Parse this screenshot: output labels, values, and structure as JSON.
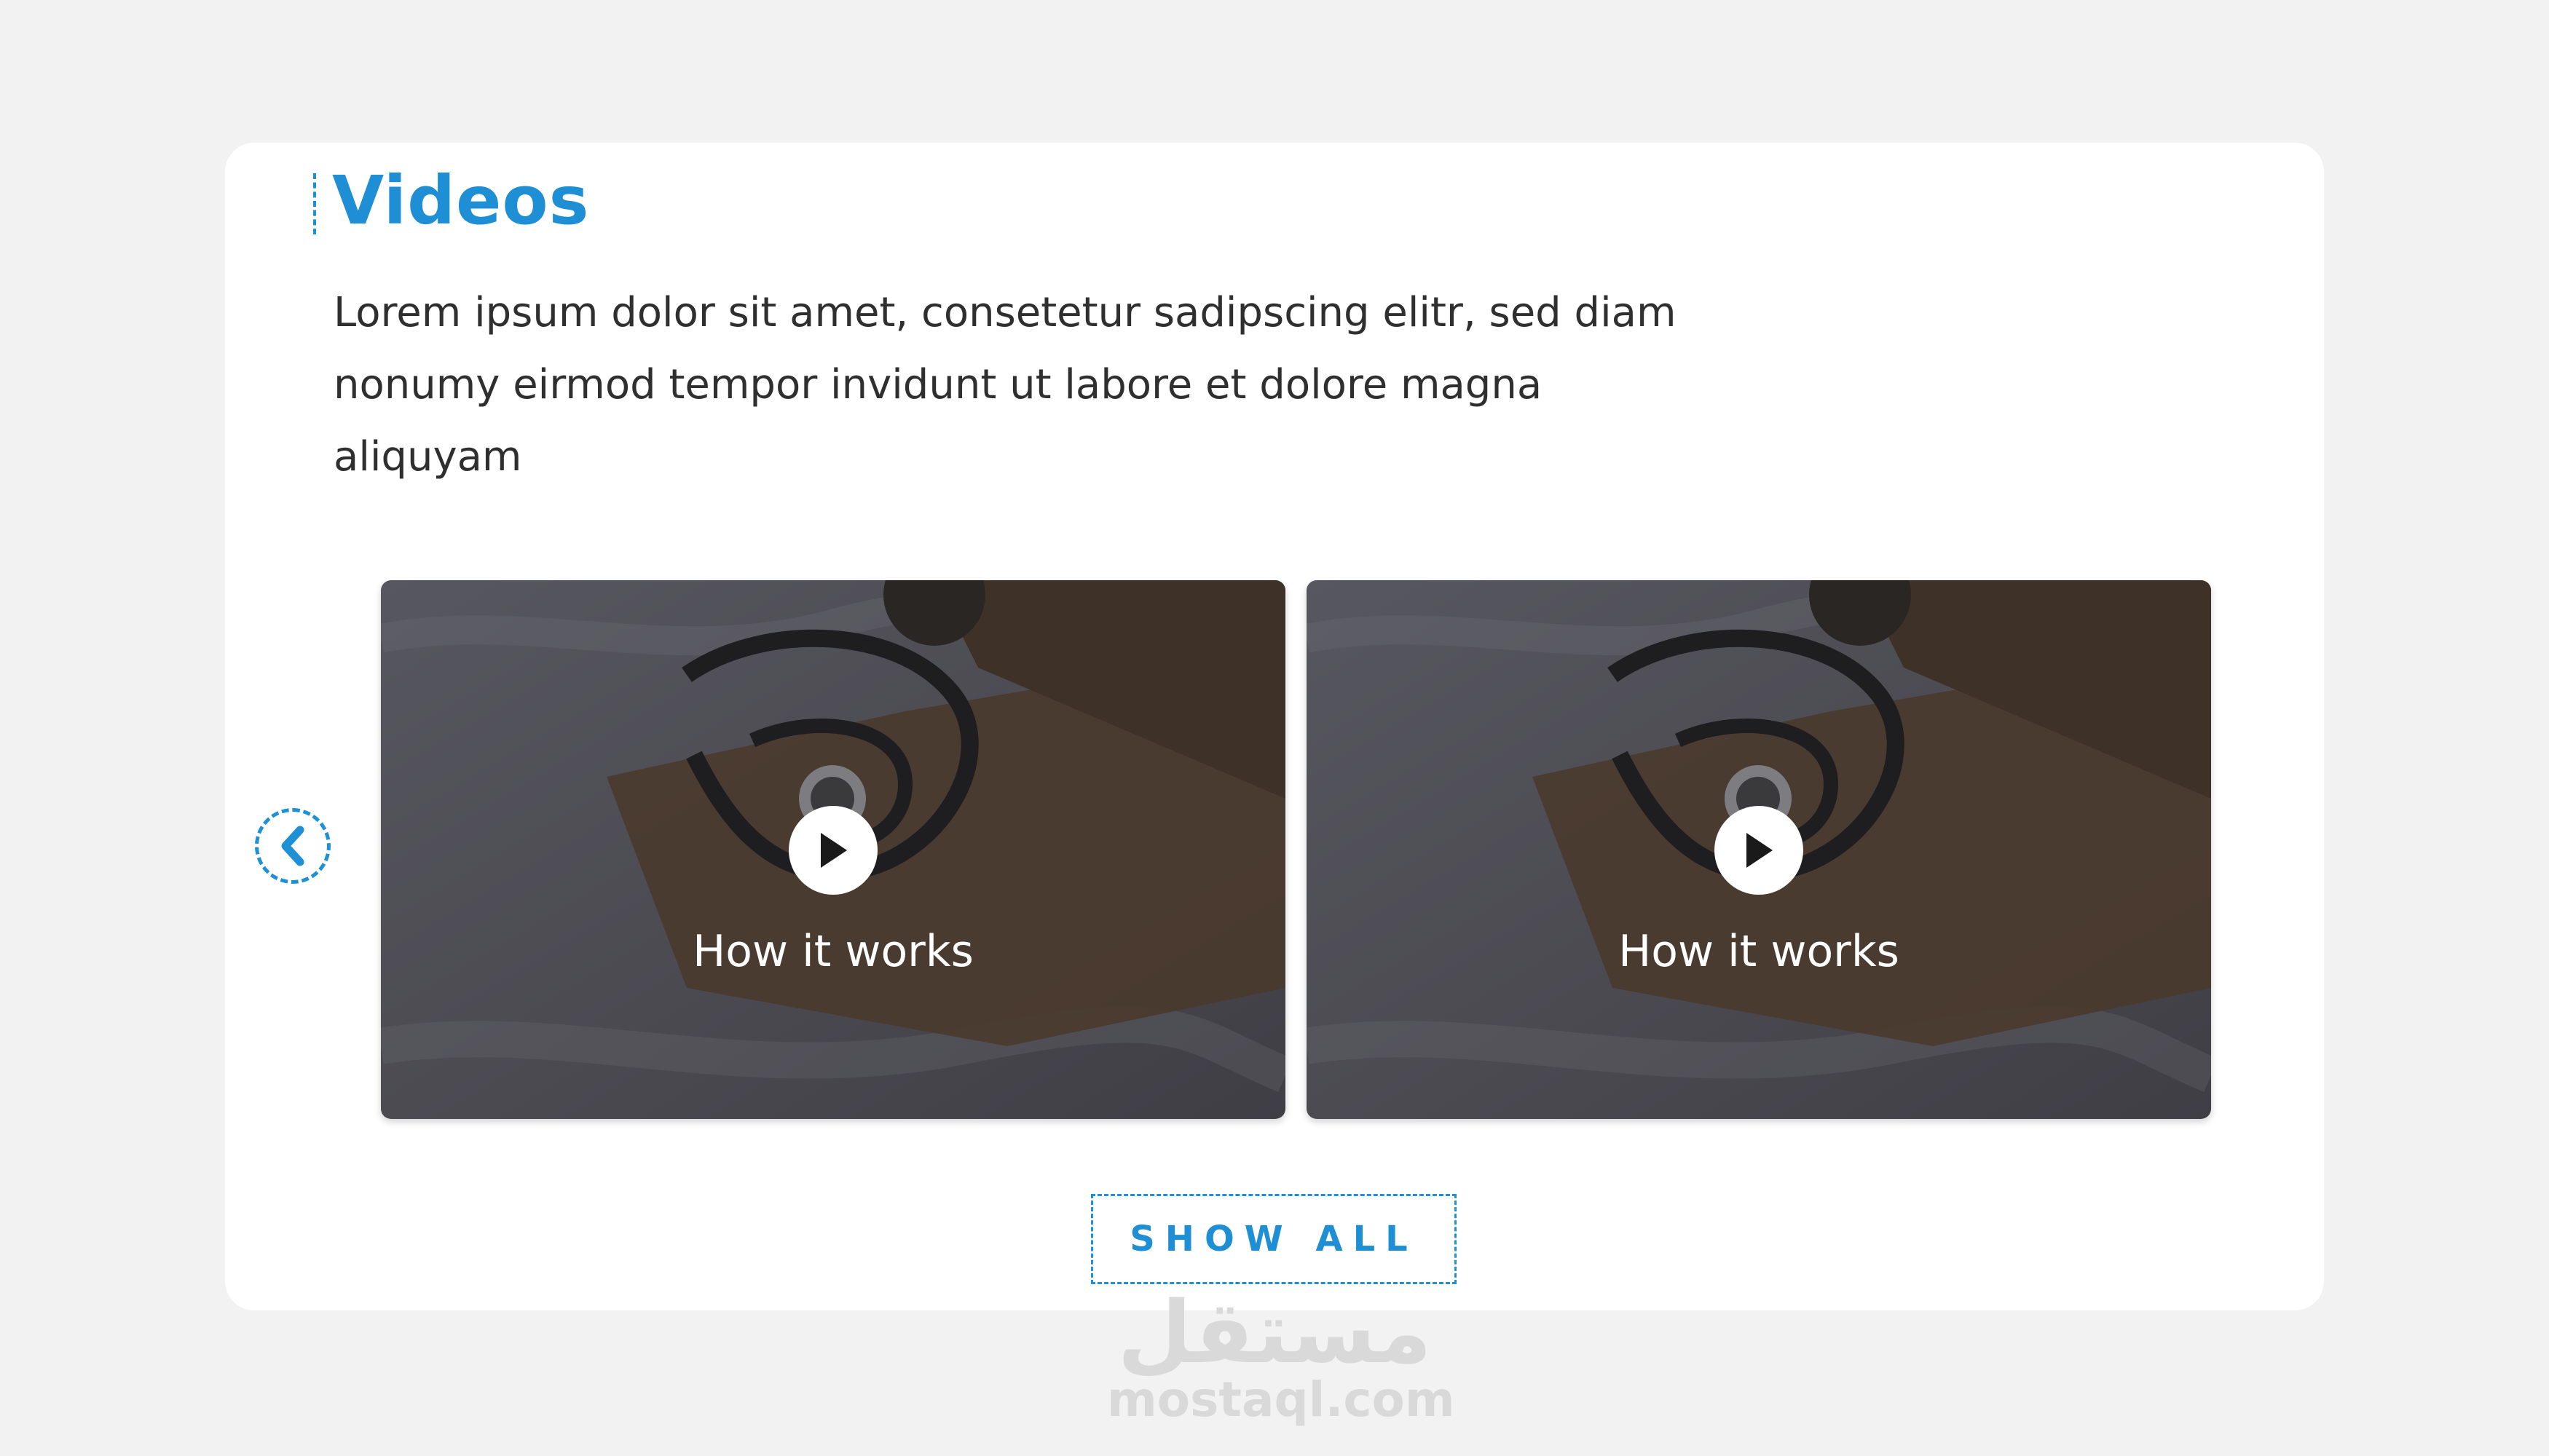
{
  "section": {
    "title": "Videos",
    "description_lines": [
      "Lorem ipsum dolor sit amet, consetetur sadipscing elitr, sed diam",
      "nonumy eirmod tempor invidunt ut labore et dolore magna aliquyam"
    ]
  },
  "carousel": {
    "prev_icon": "chevron-left-icon",
    "videos": [
      {
        "caption": "How it works",
        "icon": "play-icon"
      },
      {
        "caption": "How it works",
        "icon": "play-icon"
      }
    ]
  },
  "actions": {
    "show_all_label": "SHOW ALL"
  },
  "watermark": {
    "arabic": "مستقل",
    "domain": "mostaql.com"
  },
  "colors": {
    "accent": "#1e8fd5",
    "background": "#f2f2f2",
    "card": "#ffffff",
    "text": "#2f2f2f"
  }
}
